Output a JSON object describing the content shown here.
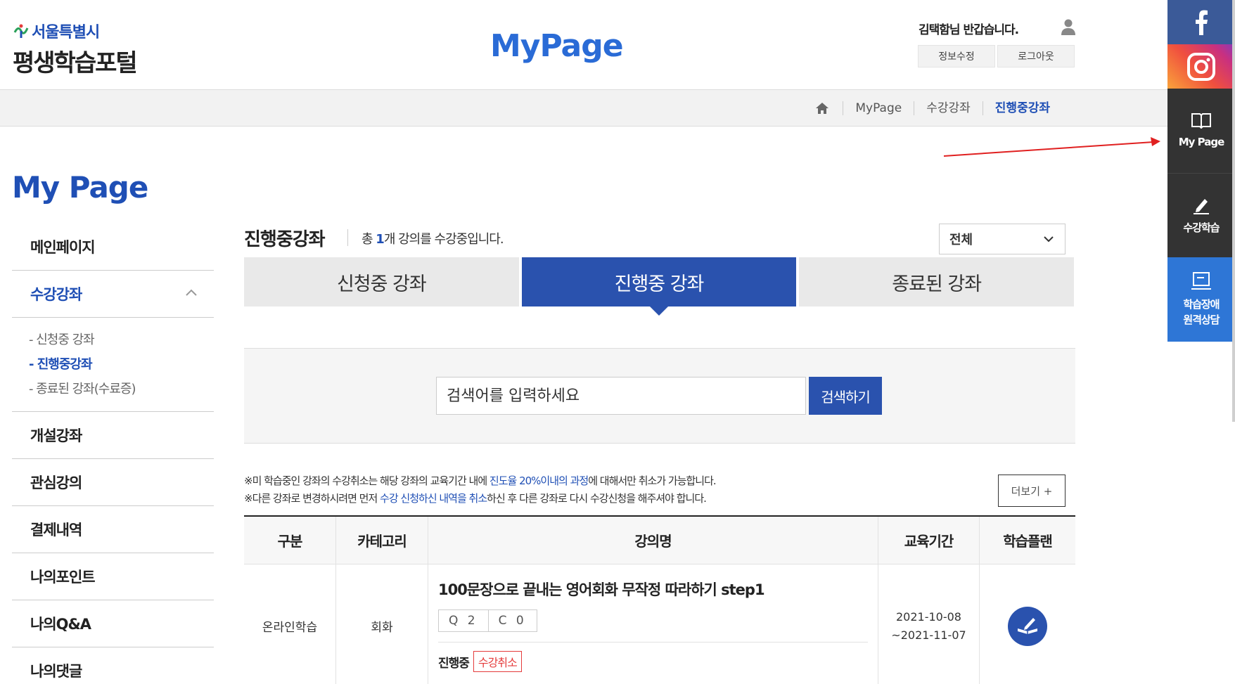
{
  "logo": {
    "city": "서울특별시",
    "portal": "평생학습포털"
  },
  "header": {
    "title": "MyPage",
    "greeting": "김택함님 반갑습니다.",
    "edit_label": "정보수정",
    "logout_label": "로그아웃"
  },
  "breadcrumb": {
    "items": [
      "MyPage",
      "수강강좌",
      "진행중강좌"
    ]
  },
  "quickbar": {
    "mypage": "My Page",
    "study": "수강학습",
    "disability_line1": "학습장애",
    "disability_line2": "원격상담"
  },
  "sidebar": {
    "title": "My Page",
    "items": [
      "메인페이지",
      "수강강좌",
      "개설강좌",
      "관심강의",
      "결제내역",
      "나의포인트",
      "나의Q&A",
      "나의댓글"
    ],
    "subitems": [
      "- 신청중 강좌",
      "- 진행중강좌",
      "- 종료된 강좌(수료증)"
    ]
  },
  "content": {
    "title": "진행중강좌",
    "total_prefix": "총",
    "total_count": "1",
    "total_suffix": "개 강의를 수강중입니다.",
    "filter_value": "전체",
    "tabs": [
      "신청중 강좌",
      "진행중 강좌",
      "종료된 강좌"
    ]
  },
  "search": {
    "placeholder": "검색어를 입력하세요",
    "button": "검색하기"
  },
  "notice": {
    "line1_a": "※미 학습중인 강좌의 수강취소는 해당 강좌의 교육기간 내에 ",
    "line1_b": "진도율 20%이내의 과정",
    "line1_c": "에 대해서만 취소가 가능합니다.",
    "line2_a": "※다른 강좌로 변경하시려면 먼저 ",
    "line2_b": "수강 신청하신 내역을 취소",
    "line2_c": "하신 후 다른 강좌로 다시 수강신청을 해주셔야 합니다.",
    "more": "더보기 +"
  },
  "table": {
    "headers": [
      "구분",
      "카테고리",
      "강의명",
      "교육기간",
      "학습플랜"
    ],
    "rows": [
      {
        "type": "온라인학습",
        "category": "회화",
        "title": "100문장으로 끝내는 영어회화 무작정 따라하기 step1",
        "q": "Q 2",
        "c": "C 0",
        "status": "진행중",
        "cancel": "수강취소",
        "period_start": "2021-10-08",
        "period_end": "~2021-11-07"
      }
    ]
  },
  "colors": {
    "primary": "#2a52ae",
    "accent_blue": "#1f4fb5",
    "heading_blue": "#2a6bd6",
    "cancel_red": "#e53b3b",
    "arrow_red": "#e02020"
  }
}
